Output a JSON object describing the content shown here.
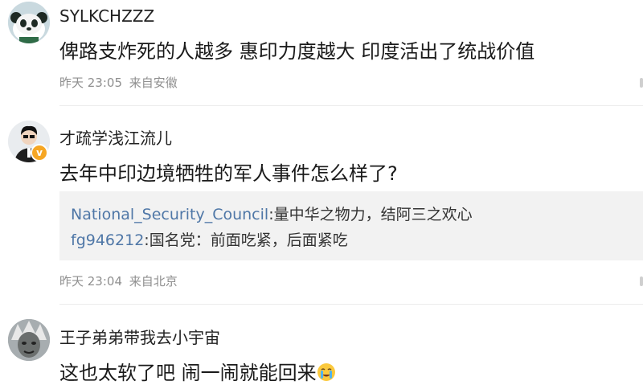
{
  "comments": [
    {
      "username": "SYLKCHZZZ",
      "text": "俾路支炸死的人越多 惠印力度越大 印度活出了统战价值",
      "time": "昨天 23:05",
      "location": "来自安徽",
      "avatar": "panda-avatar"
    },
    {
      "username": "才疏学浅江流儿",
      "text": "去年中印边境牺牲的军人事件怎么样了?",
      "time": "昨天 23:04",
      "location": "来自北京",
      "avatar": "suit-man-avatar",
      "verified": "v",
      "replies": [
        {
          "name": "National_Security_Council",
          "sep": ":",
          "text": "量中华之物力，结阿三之欢心"
        },
        {
          "name": "fg946212",
          "sep": ":",
          "text": "国名党：前面吃紧，后面紧吃"
        }
      ]
    },
    {
      "username": "王子弟弟带我去小宇宙",
      "text": "这也太软了吧 闹一闹就能回来",
      "avatar": "monster-avatar",
      "emoji": "crying-emoji"
    }
  ]
}
